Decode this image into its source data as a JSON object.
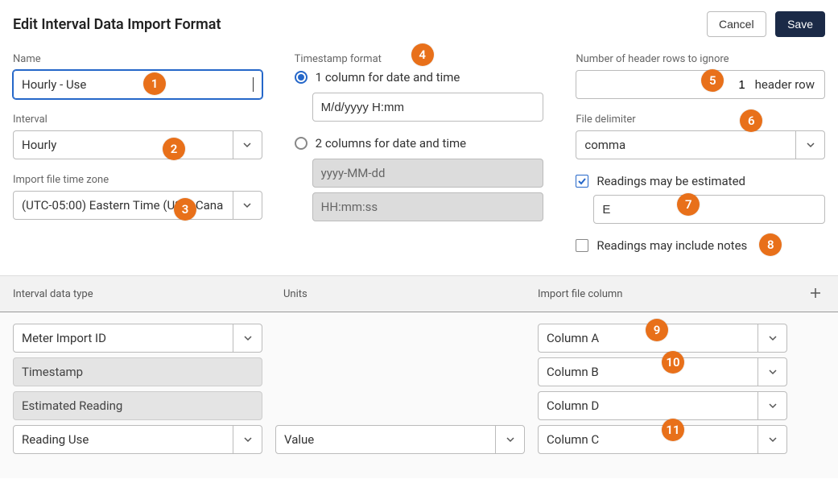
{
  "page": {
    "title": "Edit Interval Data Import Format",
    "cancel_label": "Cancel",
    "save_label": "Save"
  },
  "left": {
    "name_label": "Name",
    "name_value": "Hourly - Use",
    "interval_label": "Interval",
    "interval_value": "Hourly",
    "tz_label": "Import file time zone",
    "tz_value": "(UTC-05:00) Eastern Time (US & Cana"
  },
  "center": {
    "ts_label": "Timestamp format",
    "radio1_label": "1 column for date and time",
    "radio1_value": "M/d/yyyy H:mm",
    "radio2_label": "2 columns for date and time",
    "radio2_date_placeholder": "yyyy-MM-dd",
    "radio2_time_placeholder": "HH:mm:ss"
  },
  "right": {
    "header_rows_label": "Number of header rows to ignore",
    "header_rows_value": "1",
    "header_rows_suffix": "header row",
    "delimiter_label": "File delimiter",
    "delimiter_value": "comma",
    "estimated_label": "Readings may be estimated",
    "estimated_value": "E",
    "notes_label": "Readings may include notes"
  },
  "table": {
    "headers": {
      "col1": "Interval data type",
      "col2": "Units",
      "col3": "Import file column"
    },
    "rows": [
      {
        "type": "Meter Import ID",
        "type_kind": "select",
        "units": "",
        "units_kind": "none",
        "col": "Column A"
      },
      {
        "type": "Timestamp",
        "type_kind": "static",
        "units": "",
        "units_kind": "none",
        "col": "Column B"
      },
      {
        "type": "Estimated Reading",
        "type_kind": "static",
        "units": "",
        "units_kind": "none",
        "col": "Column D"
      },
      {
        "type": "Reading Use",
        "type_kind": "select",
        "units": "Value",
        "units_kind": "select",
        "col": "Column C"
      }
    ]
  },
  "markers": {
    "m1": "1",
    "m2": "2",
    "m3": "3",
    "m4": "4",
    "m5": "5",
    "m6": "6",
    "m7": "7",
    "m8": "8",
    "m9": "9",
    "m10": "10",
    "m11": "11"
  }
}
